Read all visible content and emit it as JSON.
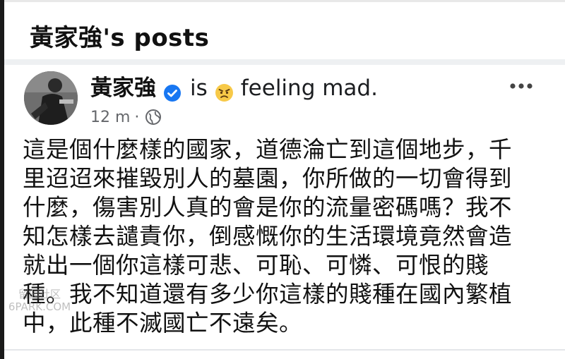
{
  "page": {
    "title": "黃家強's posts"
  },
  "post": {
    "author": "黃家強",
    "verified_icon": "verified-badge-icon",
    "activity_is": "is",
    "feeling_icon": "angry-face-icon",
    "feeling_text": "feeling mad.",
    "timestamp": "12 m",
    "meta_separator": "·",
    "privacy_icon": "globe-icon",
    "more_icon": "more-horizontal-icon",
    "body_lines": [
      "這是個什麼樣的國家，道德淪亡到這個地步，千",
      "里迢迢來摧毀別人的墓園，你所做的一切會得到",
      "什麼，傷害別人真的會是你的流量密碼嗎？我不",
      "知怎樣去譴責你，倒感慨你的生活環境竟然會造",
      "就出一個你這樣可悲、可恥、可憐、可恨的賤",
      "種。我不知道還有多少你這樣的賤種在國內繁植",
      "中，此種不滅國亡不遠矣。"
    ]
  },
  "watermark": {
    "line1": "留园社区",
    "line2": "6PARK.COM"
  },
  "colors": {
    "verified_blue": "#1877f2",
    "meta_gray": "#65676b",
    "emoji_yellow": "#f7c948"
  }
}
